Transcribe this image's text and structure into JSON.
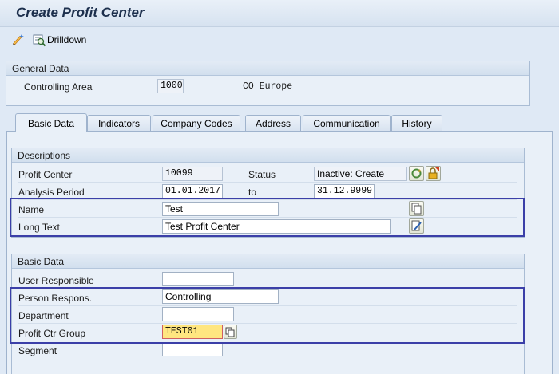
{
  "header": {
    "title": "Create Profit Center"
  },
  "toolbar": {
    "drilldown_label": "Drilldown",
    "icons": [
      "pencil-wand-icon",
      "drilldown-icon"
    ]
  },
  "general_data": {
    "title": "General Data",
    "controlling_area_label": "Controlling Area",
    "controlling_area_value": "1000",
    "controlling_area_desc": "CO Europe"
  },
  "tabs": [
    {
      "label": "Basic Data",
      "active": true
    },
    {
      "label": "Indicators"
    },
    {
      "label": "Company Codes"
    },
    {
      "label": "Address"
    },
    {
      "label": "Communication"
    },
    {
      "label": "History"
    }
  ],
  "descriptions": {
    "title": "Descriptions",
    "profit_center_label": "Profit Center",
    "profit_center_value": "10099",
    "status_label": "Status",
    "status_value": "Inactive: Create",
    "analysis_period_label": "Analysis Period",
    "analysis_from": "01.01.2017",
    "to_label": "to",
    "analysis_to": "31.12.9999",
    "name_label": "Name",
    "name_value": "Test",
    "long_text_label": "Long Text",
    "long_text_value": "Test Profit Center"
  },
  "basic_data": {
    "title": "Basic Data",
    "user_responsible_label": "User Responsible",
    "user_responsible_value": "",
    "person_respons_label": "Person Respons.",
    "person_respons_value": "Controlling",
    "department_label": "Department",
    "department_value": "",
    "profit_ctr_group_label": "Profit Ctr Group",
    "profit_ctr_group_value": "TEST01",
    "segment_label": "Segment",
    "segment_value": ""
  },
  "colors": {
    "highlight": "#3b3fa8",
    "required_field": "#ffe680",
    "title_text": "#1c2f4c"
  }
}
